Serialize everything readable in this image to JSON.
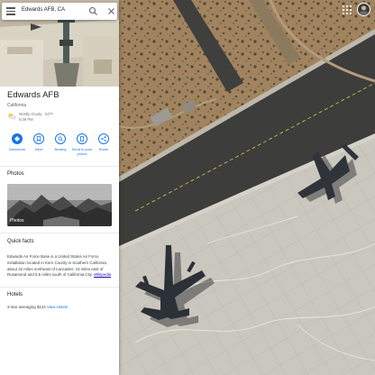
{
  "search": {
    "query": "Edwards AFB, CA"
  },
  "place": {
    "name": "Edwards AFB",
    "region": "California",
    "weather_condition": "Mostly cloudy · 53°F",
    "weather_time": "5:09 PM"
  },
  "actions": [
    {
      "label": "Directions",
      "icon": "directions-icon"
    },
    {
      "label": "Save",
      "icon": "bookmark-icon"
    },
    {
      "label": "Nearby",
      "icon": "nearby-icon"
    },
    {
      "label": "Send to your phone",
      "icon": "phone-icon"
    },
    {
      "label": "Share",
      "icon": "share-icon"
    }
  ],
  "photos": {
    "heading": "Photos",
    "tile_label": "Photos"
  },
  "quick_facts": {
    "heading": "Quick facts",
    "text": "Edwards Air Force Base is a United States Air Force installation located in Kern County in Southern California, about 22 miles northeast of Lancaster, 15 miles east of Rosamond and 5.5 miles south of California City.",
    "link": "Wikipedia"
  },
  "hotels": {
    "heading": "Hotels",
    "text": "3-star averaging $124",
    "link": "View Hotels"
  },
  "colors": {
    "accent": "#1a73e8",
    "tarmac": "#c9c6bd",
    "desert": "#9c7f5c"
  }
}
